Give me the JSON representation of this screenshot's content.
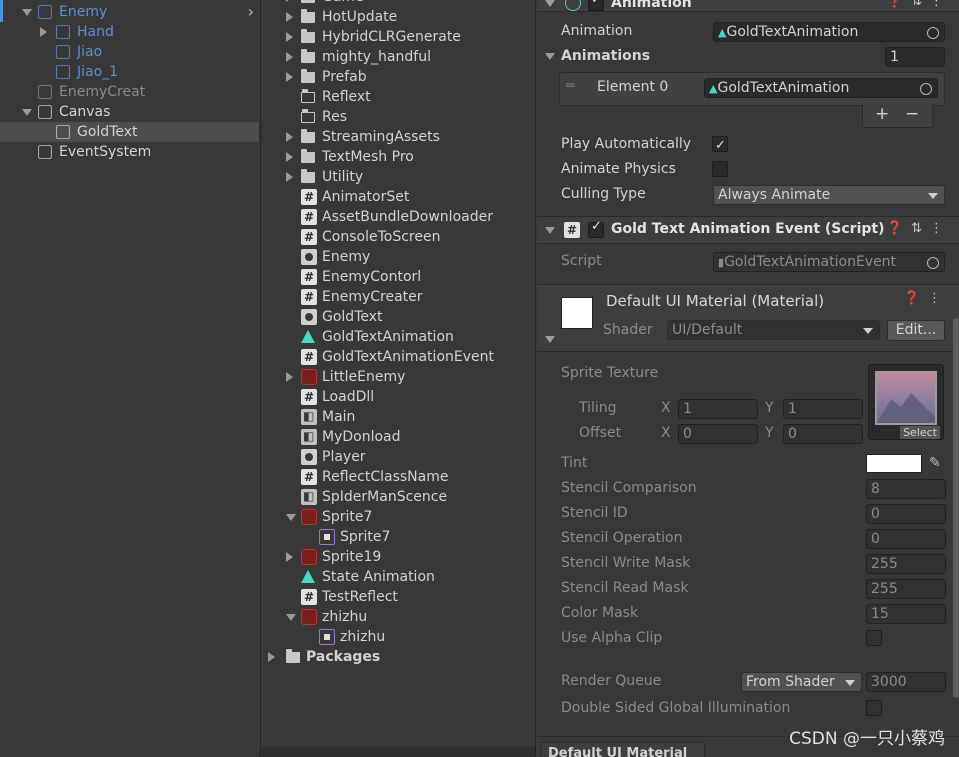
{
  "hierarchy": {
    "items": [
      {
        "label": "Enemy",
        "icon": "cube-icon",
        "style": "blue",
        "indent": 0,
        "arrow": "down"
      },
      {
        "label": "Hand",
        "icon": "cube-icon",
        "style": "blue",
        "indent": 1,
        "arrow": "right"
      },
      {
        "label": "Jiao",
        "icon": "cube-icon",
        "style": "blue",
        "indent": 1,
        "arrow": ""
      },
      {
        "label": "Jiao_1",
        "icon": "cube-icon",
        "style": "blue",
        "indent": 1,
        "arrow": ""
      },
      {
        "label": "EnemyCreat",
        "icon": "cube-icon",
        "style": "dim",
        "indent": 0,
        "arrow": ""
      },
      {
        "label": "Canvas",
        "icon": "cube-icon",
        "style": "normal",
        "indent": 0,
        "arrow": "down"
      },
      {
        "label": "GoldText",
        "icon": "cube-icon",
        "style": "selected",
        "indent": 1,
        "arrow": ""
      },
      {
        "label": "EventSystem",
        "icon": "cube-icon",
        "style": "normal",
        "indent": 0,
        "arrow": ""
      }
    ]
  },
  "project": {
    "items": [
      {
        "label": "Game",
        "icon": "folder-icon",
        "arrow": "right",
        "indent": 0
      },
      {
        "label": "HotUpdate",
        "icon": "folder-icon",
        "arrow": "right",
        "indent": 0
      },
      {
        "label": "HybridCLRGenerate",
        "icon": "folder-icon",
        "arrow": "right",
        "indent": 0
      },
      {
        "label": "mighty_handful",
        "icon": "folder-icon",
        "arrow": "right",
        "indent": 0
      },
      {
        "label": "Prefab",
        "icon": "folder-icon",
        "arrow": "right",
        "indent": 0
      },
      {
        "label": "Reflext",
        "icon": "folder-open-icon",
        "arrow": "",
        "indent": 0
      },
      {
        "label": "Res",
        "icon": "folder-open-icon",
        "arrow": "",
        "indent": 0
      },
      {
        "label": "StreamingAssets",
        "icon": "folder-icon",
        "arrow": "right",
        "indent": 0
      },
      {
        "label": "TextMesh Pro",
        "icon": "folder-icon",
        "arrow": "right",
        "indent": 0
      },
      {
        "label": "Utility",
        "icon": "folder-icon",
        "arrow": "right",
        "indent": 0
      },
      {
        "label": "AnimatorSet",
        "icon": "script-icon",
        "arrow": "",
        "indent": 0
      },
      {
        "label": "AssetBundleDownloader",
        "icon": "script-icon",
        "arrow": "",
        "indent": 0
      },
      {
        "label": "ConsoleToScreen",
        "icon": "script-icon",
        "arrow": "",
        "indent": 0
      },
      {
        "label": "Enemy",
        "icon": "prefab-icon",
        "arrow": "",
        "indent": 0
      },
      {
        "label": "EnemyContorl",
        "icon": "script-icon",
        "arrow": "",
        "indent": 0
      },
      {
        "label": "EnemyCreater",
        "icon": "script-icon",
        "arrow": "",
        "indent": 0
      },
      {
        "label": "GoldText",
        "icon": "prefab-icon",
        "arrow": "",
        "indent": 0
      },
      {
        "label": "GoldTextAnimation",
        "icon": "animation-icon",
        "arrow": "",
        "indent": 0
      },
      {
        "label": "GoldTextAnimationEvent",
        "icon": "script-icon",
        "arrow": "",
        "indent": 0
      },
      {
        "label": "LittleEnemy",
        "icon": "sprite-icon",
        "arrow": "right",
        "indent": 0
      },
      {
        "label": "LoadDll",
        "icon": "script-icon",
        "arrow": "",
        "indent": 0
      },
      {
        "label": "Main",
        "icon": "scene-icon",
        "arrow": "",
        "indent": 0
      },
      {
        "label": "MyDonload",
        "icon": "scene-icon",
        "arrow": "",
        "indent": 0
      },
      {
        "label": "Player",
        "icon": "prefab-icon",
        "arrow": "",
        "indent": 0
      },
      {
        "label": "ReflectClassName",
        "icon": "script-icon",
        "arrow": "",
        "indent": 0
      },
      {
        "label": "SpIderManScence",
        "icon": "scene-icon",
        "arrow": "",
        "indent": 0
      },
      {
        "label": "Sprite7",
        "icon": "sprite-icon",
        "arrow": "down",
        "indent": 0
      },
      {
        "label": "Sprite7",
        "icon": "sprite-child-icon",
        "arrow": "",
        "indent": 1
      },
      {
        "label": "Sprite19",
        "icon": "sprite-icon",
        "arrow": "right",
        "indent": 0
      },
      {
        "label": "State Animation",
        "icon": "animation-icon",
        "arrow": "",
        "indent": 0
      },
      {
        "label": "TestReflect",
        "icon": "script-icon",
        "arrow": "",
        "indent": 0
      },
      {
        "label": "zhizhu",
        "icon": "sprite-icon",
        "arrow": "down",
        "indent": 0
      },
      {
        "label": "zhizhu",
        "icon": "sprite-child-icon",
        "arrow": "",
        "indent": 1
      }
    ],
    "packages_label": "Packages"
  },
  "inspector": {
    "animation": {
      "title": "Animation",
      "animation_label": "Animation",
      "animation_value": "GoldTextAnimation",
      "animations_label": "Animations",
      "animations_count": "1",
      "element_label": "Element 0",
      "element_value": "GoldTextAnimation",
      "add": "+",
      "remove": "−",
      "play_auto_label": "Play Automatically",
      "play_auto": true,
      "animate_physics_label": "Animate Physics",
      "animate_physics": false,
      "culling_label": "Culling Type",
      "culling_value": "Always Animate"
    },
    "script_comp": {
      "title": "Gold Text Animation Event (Script)",
      "script_label": "Script",
      "script_value": "GoldTextAnimationEvent"
    },
    "material": {
      "title": "Default UI Material (Material)",
      "shader_label": "Shader",
      "shader_value": "UI/Default",
      "edit_label": "Edit...",
      "sprite_texture_label": "Sprite Texture",
      "select_label": "Select",
      "tiling_label": "Tiling",
      "offset_label": "Offset",
      "x_label": "X",
      "y_label": "Y",
      "tiling_x": "1",
      "tiling_y": "1",
      "offset_x": "0",
      "offset_y": "0",
      "tint_label": "Tint",
      "props": [
        {
          "label": "Stencil Comparison",
          "value": "8"
        },
        {
          "label": "Stencil ID",
          "value": "0"
        },
        {
          "label": "Stencil Operation",
          "value": "0"
        },
        {
          "label": "Stencil Write Mask",
          "value": "255"
        },
        {
          "label": "Stencil Read Mask",
          "value": "255"
        },
        {
          "label": "Color Mask",
          "value": "15"
        }
      ],
      "alpha_clip_label": "Use Alpha Clip",
      "render_queue_label": "Render Queue",
      "render_queue_mode": "From Shader",
      "render_queue_value": "3000",
      "double_sided_label": "Double Sided Global Illumination",
      "bottom_tab": "Default UI Material"
    }
  },
  "watermark": "CSDN @一只小蔡鸡",
  "colors": {
    "accent_teal": "#47d6c6",
    "selection": "#4d4d4d",
    "prefab_blue": "#5e8fd6"
  }
}
